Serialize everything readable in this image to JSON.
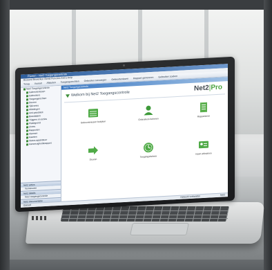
{
  "app": {
    "title": "Paxton - Net2 Toegangscontrole",
    "menu": "Bestand  Bewerken  Beeld  Functies  Extra  Help",
    "toolbar": [
      "Terug",
      "Vooruit",
      "Afsluiten",
      "Toegangsrechten",
      "Gebruiker toevoegen",
      "Gebeurtenissen",
      "Rapport genereren",
      "Gebruiker zoeken"
    ],
    "tree": [
      {
        "label": "Net2 Toegangscontrole",
        "sub": false
      },
      {
        "label": "Gebeurtenissen",
        "sub": true
      },
      {
        "label": "Gebruikers",
        "sub": true
      },
      {
        "label": "Toegangsrechten",
        "sub": true
      },
      {
        "label": "Deuren",
        "sub": true
      },
      {
        "label": "Tijdzones",
        "sub": true
      },
      {
        "label": "Afdelingen",
        "sub": true
      },
      {
        "label": "Anti-passback",
        "sub": true
      },
      {
        "label": "Brandalarm",
        "sub": true
      },
      {
        "label": "Triggers en acties",
        "sub": true
      },
      {
        "label": "Plattegrond",
        "sub": true
      },
      {
        "label": "Zones",
        "sub": true
      },
      {
        "label": "Rapporten",
        "sub": true
      },
      {
        "label": "Alarmen",
        "sub": true
      },
      {
        "label": "Kaarten",
        "sub": true
      },
      {
        "label": "Status apparatuur",
        "sub": true
      },
      {
        "label": "Aanwezigheidsrapport",
        "sub": true
      }
    ],
    "side_panel": {
      "head1": "Net2 acties",
      "item1": "Vernieuwen",
      "head2": "Net2 details",
      "item2": "Net2 toegangscontrole",
      "head3": "Net2 documentatie"
    },
    "main_tab": "Net2 Toegangscontrole",
    "welcome": "Welkom bij Net2 Toegangscontrole",
    "logo_net2": "Net2",
    "logo_pro": "Pro",
    "tiles": [
      {
        "label": "Gebeurtenissen bekijken",
        "icon": "calendar-icon",
        "color": "#4faa46"
      },
      {
        "label": "Gebruikers beheren",
        "icon": "user-icon",
        "color": "#3e9a3a"
      },
      {
        "label": "Rapporteren",
        "icon": "report-icon",
        "color": "#5cb04f"
      },
      {
        "label": "Deuren",
        "icon": "door-arrow-icon",
        "color": "#4faa46"
      },
      {
        "label": "Toegangsbeheer",
        "icon": "clock-icon",
        "color": "#4faa46"
      },
      {
        "label": "Kaart afdrukken",
        "icon": "card-icon",
        "color": "#4faa46"
      }
    ],
    "status_left": "Gereed",
    "status_mid": "Netwerk verbonden",
    "status_right": "Net2"
  }
}
